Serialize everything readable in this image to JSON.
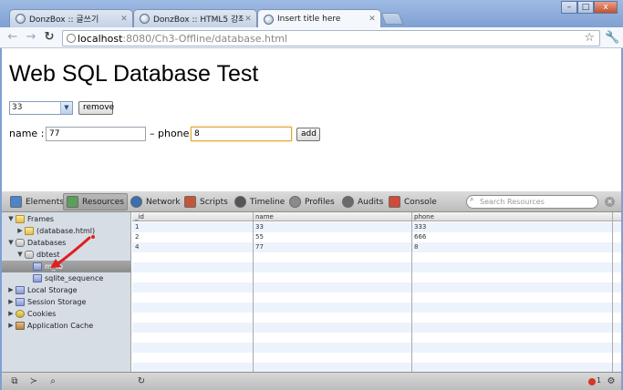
{
  "browser": {
    "tabs": [
      {
        "title": "DonzBox :: 글쓰기",
        "active": false
      },
      {
        "title": "DonzBox :: HTML5 강좌 (",
        "active": false
      },
      {
        "title": "Insert title here",
        "active": true
      }
    ],
    "window_buttons": {
      "minimize": "–",
      "maximize": "□",
      "close": "x"
    },
    "url_host": "localhost",
    "url_rest": ":8080/Ch3-Offline/database.html"
  },
  "page": {
    "title": "Web SQL Database Test",
    "select_value": "33",
    "remove_label": "remove",
    "name_label": "name :",
    "name_value": "77",
    "phone_label": "– phone",
    "phone_value": "8",
    "add_label": "add"
  },
  "devtools": {
    "tabs": [
      {
        "label": "Elements",
        "active": false,
        "icon": "elements-icon",
        "color": "#4c86c9"
      },
      {
        "label": "Resources",
        "active": true,
        "icon": "resources-icon",
        "color": "#5aa05a"
      },
      {
        "label": "Network",
        "active": false,
        "icon": "network-icon",
        "color": "#3a6fb0"
      },
      {
        "label": "Scripts",
        "active": false,
        "icon": "scripts-icon",
        "color": "#c7553a"
      },
      {
        "label": "Timeline",
        "active": false,
        "icon": "timeline-icon",
        "color": "#555555"
      },
      {
        "label": "Profiles",
        "active": false,
        "icon": "profiles-icon",
        "color": "#8a8a8a"
      },
      {
        "label": "Audits",
        "active": false,
        "icon": "audits-icon",
        "color": "#6a6a6a"
      },
      {
        "label": "Console",
        "active": false,
        "icon": "console-icon",
        "color": "#d04a3a"
      }
    ],
    "search_placeholder": "Search Resources",
    "tree": {
      "frames": "Frames",
      "frame_child": "(database.html)",
      "databases": "Databases",
      "dbtest": "dbtest",
      "table_selected": "m_tb",
      "sqlite_sequence": "sqlite_sequence",
      "local_storage": "Local Storage",
      "session_storage": "Session Storage",
      "cookies": "Cookies",
      "app_cache": "Application Cache"
    },
    "grid": {
      "columns": [
        "_id",
        "name",
        "phone"
      ],
      "rows": [
        [
          "1",
          "33",
          "333"
        ],
        [
          "2",
          "55",
          "666"
        ],
        [
          "4",
          "77",
          "8"
        ]
      ]
    },
    "error_count": "1",
    "annotation_color": "#e02020"
  }
}
